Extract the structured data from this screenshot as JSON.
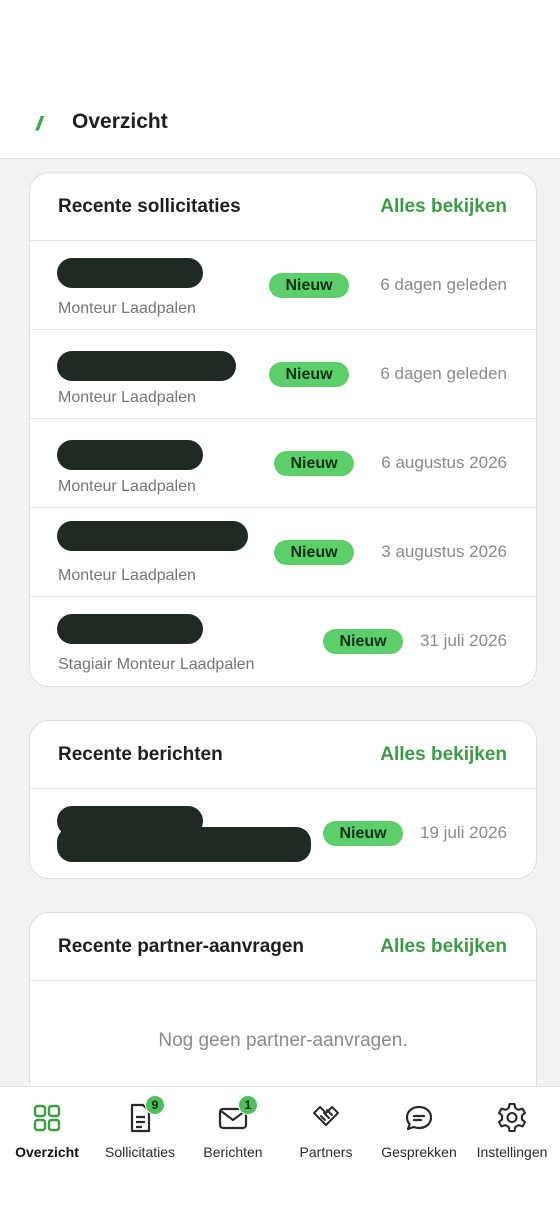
{
  "header": {
    "logo": "//",
    "title": "Overzicht"
  },
  "applications": {
    "title": "Recente sollicitaties",
    "see_all": "Alles bekijken",
    "rows": [
      {
        "role": "Monteur Laadpalen",
        "badge": "Nieuw",
        "date": "6 dagen geleden"
      },
      {
        "role": "Monteur Laadpalen",
        "badge": "Nieuw",
        "date": "6 dagen geleden"
      },
      {
        "role": "Monteur Laadpalen",
        "badge": "Nieuw",
        "date": "6 augustus 2026"
      },
      {
        "role": "Monteur Laadpalen",
        "badge": "Nieuw",
        "date": "3 augustus 2026"
      },
      {
        "role": "Stagiair Monteur Laadpalen",
        "badge": "Nieuw",
        "date": "31 juli 2026"
      }
    ]
  },
  "messages": {
    "title": "Recente berichten",
    "see_all": "Alles bekijken",
    "rows": [
      {
        "badge": "Nieuw",
        "date": "19 juli 2026"
      }
    ]
  },
  "partners": {
    "title": "Recente partner-aanvragen",
    "see_all": "Alles bekijken",
    "empty": "Nog geen partner-aanvragen."
  },
  "nav": {
    "items": [
      {
        "label": "Overzicht",
        "icon": "grid-icon"
      },
      {
        "label": "Sollicitaties",
        "icon": "document-icon",
        "badge": "9"
      },
      {
        "label": "Berichten",
        "icon": "mail-icon",
        "badge": "1"
      },
      {
        "label": "Partners",
        "icon": "handshake-icon"
      },
      {
        "label": "Gesprekken",
        "icon": "chat-icon"
      },
      {
        "label": "Instellingen",
        "icon": "gear-icon"
      }
    ]
  },
  "colors": {
    "accent": "#3f9a45",
    "badge": "#5ccf6a",
    "background": "#f2f3f1"
  }
}
